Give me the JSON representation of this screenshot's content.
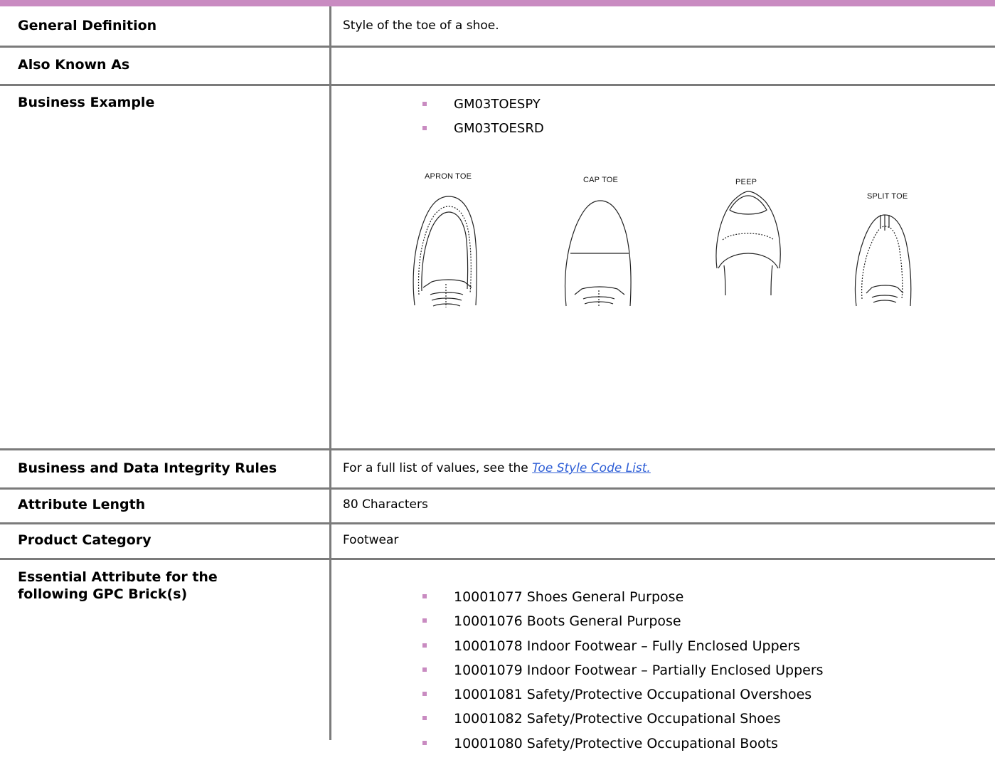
{
  "accent_color": "#c98bc1",
  "rows": {
    "general_definition": {
      "label": "General Definition",
      "value": "Style of the toe of a shoe."
    },
    "also_known_as": {
      "label": "Also Known As",
      "value": ""
    },
    "business_example": {
      "label": "Business Example",
      "codes": [
        "GM03TOESPY",
        "GM03TOESRD"
      ],
      "illustrations": [
        "APRON TOE",
        "CAP TOE",
        "PEEP",
        "SPLIT TOE"
      ]
    },
    "integrity_rules": {
      "label": "Business and Data Integrity Rules",
      "prefix": "For a full list of values, see the ",
      "link": "Toe Style Code List."
    },
    "attribute_length": {
      "label": "Attribute Length",
      "value": "80 Characters"
    },
    "product_category": {
      "label": "Product Category",
      "value": "Footwear"
    },
    "gpc_bricks": {
      "label_line1": "Essential Attribute for the",
      "label_line2": "following GPC Brick(s)",
      "items": [
        "10001077 Shoes General Purpose",
        "10001076 Boots General Purpose",
        "10001078 Indoor Footwear – Fully Enclosed Uppers",
        "10001079 Indoor Footwear – Partially Enclosed Uppers",
        "10001081 Safety/Protective Occupational Overshoes",
        "10001082 Safety/Protective Occupational Shoes",
        "10001080 Safety/Protective Occupational Boots"
      ]
    }
  }
}
